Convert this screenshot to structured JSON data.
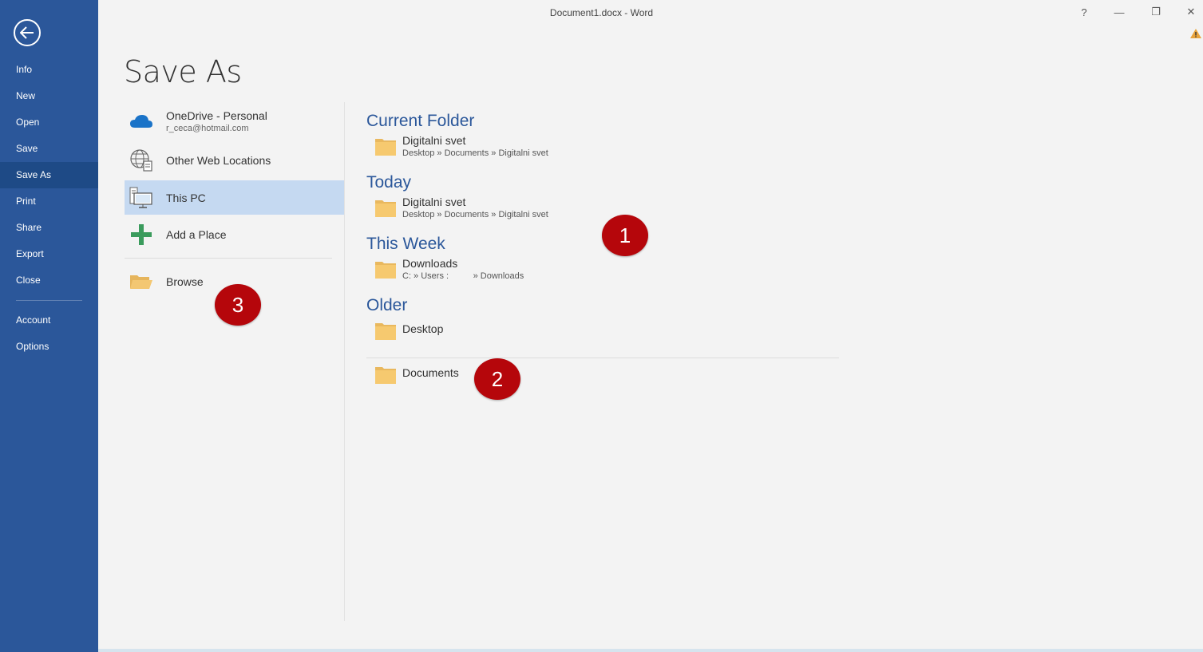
{
  "window": {
    "title": "Document1.docx - Word",
    "controls": {
      "help": "?",
      "minimize": "—",
      "restore": "❐",
      "close": "✕"
    }
  },
  "sidebar": {
    "back_icon": "back-arrow-icon",
    "items": [
      {
        "label": "Info"
      },
      {
        "label": "New"
      },
      {
        "label": "Open"
      },
      {
        "label": "Save"
      },
      {
        "label": "Save As",
        "active": true
      },
      {
        "label": "Print"
      },
      {
        "label": "Share"
      },
      {
        "label": "Export"
      },
      {
        "label": "Close"
      },
      {
        "label": "Account"
      },
      {
        "label": "Options"
      }
    ]
  },
  "page": {
    "title": "Save As"
  },
  "locations": [
    {
      "name": "OneDrive - Personal",
      "sub": "r_ceca@hotmail.com",
      "icon": "onedrive-cloud-icon"
    },
    {
      "name": "Other Web Locations",
      "icon": "globe-icon"
    },
    {
      "name": "This PC",
      "icon": "computer-icon",
      "selected": true
    },
    {
      "name": "Add a Place",
      "icon": "plus-icon"
    },
    {
      "name": "Browse",
      "icon": "folder-open-icon"
    }
  ],
  "sections": {
    "current": {
      "heading": "Current Folder",
      "items": [
        {
          "name": "Digitalni svet",
          "path": "Desktop » Documents » Digitalni svet"
        }
      ]
    },
    "today": {
      "heading": "Today",
      "items": [
        {
          "name": "Digitalni svet",
          "path": "Desktop » Documents » Digitalni svet"
        }
      ]
    },
    "week": {
      "heading": "This Week",
      "items": [
        {
          "name": "Downloads",
          "path": "C: » Users :          » Downloads"
        }
      ]
    },
    "older": {
      "heading": "Older",
      "items": [
        {
          "name": "Desktop"
        },
        {
          "name": "Documents"
        }
      ]
    }
  },
  "badges": {
    "one": "1",
    "two": "2",
    "three": "3"
  },
  "colors": {
    "accent": "#2b579a",
    "selected": "#c5d9f1",
    "badge": "#b5060b",
    "folder": "#f3c772"
  }
}
